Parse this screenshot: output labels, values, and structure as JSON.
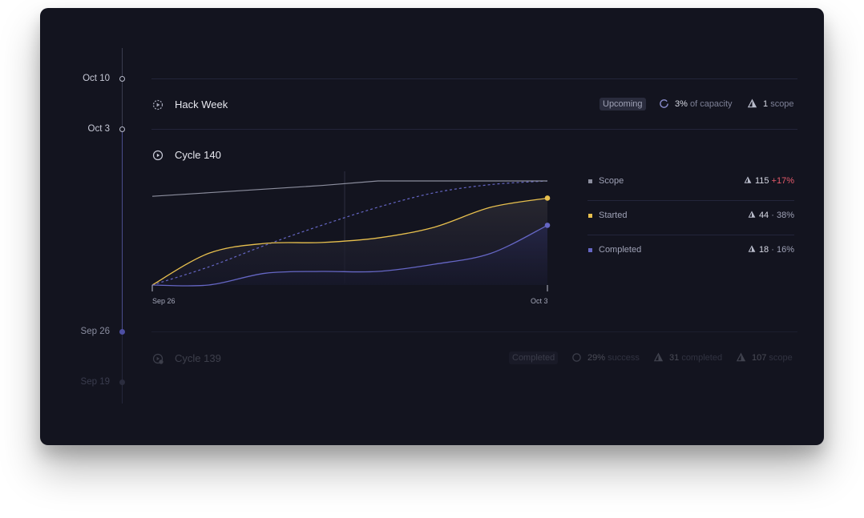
{
  "timeline": {
    "dates": [
      "Oct 10",
      "Oct 3",
      "Sep 26",
      "Sep 19"
    ]
  },
  "rows": {
    "hack_week": {
      "title": "Hack Week",
      "badge": "Upcoming",
      "capacity_value": "3%",
      "capacity_text": "of capacity",
      "scope_value": "1",
      "scope_text": "scope"
    },
    "cycle_140": {
      "title": "Cycle 140"
    },
    "cycle_139": {
      "title": "Cycle 139",
      "badge": "Completed",
      "success_value": "29%",
      "success_text": "success",
      "completed_value": "31",
      "completed_text": "completed",
      "scope_value": "107",
      "scope_text": "scope"
    }
  },
  "legend": {
    "scope": {
      "label": "Scope",
      "value": "115",
      "change": "+17%",
      "color": "#8c8e9e"
    },
    "started": {
      "label": "Started",
      "value": "44",
      "percent": "· 38%",
      "color": "#e8c04e"
    },
    "completed": {
      "label": "Completed",
      "value": "18",
      "percent": "· 16%",
      "color": "#6566c4"
    }
  },
  "chart_data": {
    "type": "line",
    "x_start_label": "Sep 26",
    "x_end_label": "Oct 3",
    "x": [
      0,
      1,
      2,
      3,
      4,
      5,
      6,
      7
    ],
    "xlim": [
      0,
      7
    ],
    "ylim": [
      0,
      115
    ],
    "series": [
      {
        "name": "Scope",
        "values": [
          98,
          102,
          106,
          110,
          115,
          115,
          115,
          115
        ]
      },
      {
        "name": "Started",
        "values": [
          0,
          35,
          46,
          47,
          52,
          64,
          86,
          96
        ]
      },
      {
        "name": "Completed",
        "values": [
          0,
          0,
          13,
          15,
          15,
          23,
          35,
          66
        ]
      }
    ],
    "target_values": [
      0,
      20,
      44,
      66,
      86,
      102,
      111,
      115
    ],
    "colors": {
      "scope": "#8c8e9e",
      "started": "#e8c04e",
      "completed": "#6566c4",
      "target": "#6566c4"
    }
  }
}
